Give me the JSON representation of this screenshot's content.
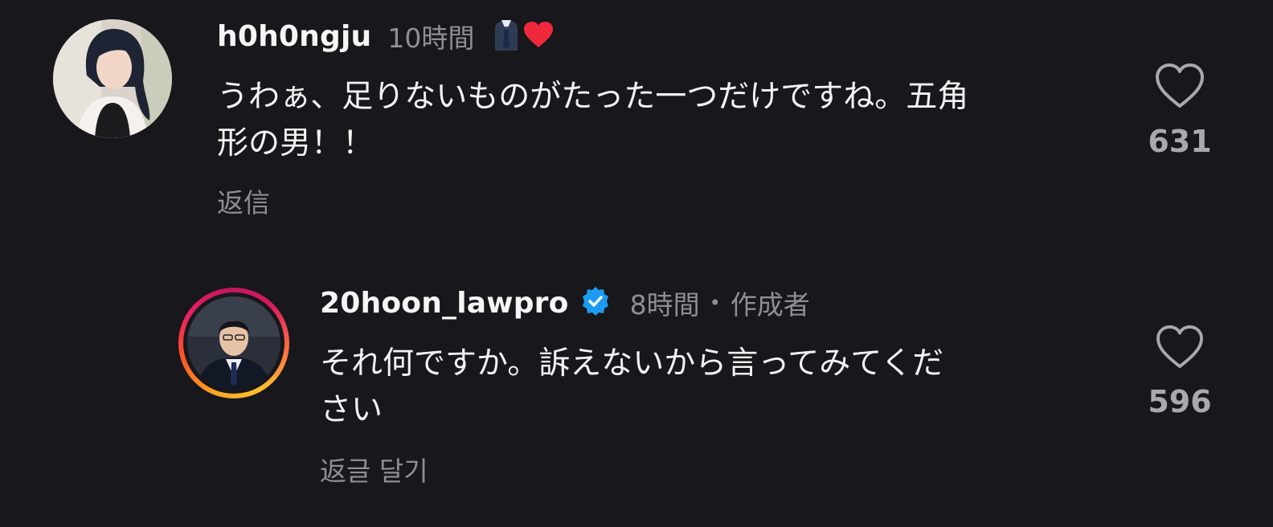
{
  "comments": [
    {
      "username": "h0h0ngju",
      "time": "10時間",
      "badge_icons": [
        "suit-emoji",
        "red-heart-emoji"
      ],
      "text_line1": "うわぁ、足りないものがたった一つだけですね。五角",
      "text_line2": "形の男！！",
      "reply_label": "返信",
      "like_count": "631"
    },
    {
      "username": "20hoon_lawpro",
      "verified": true,
      "time": "8時間",
      "separator": "•",
      "author_tag": "作成者",
      "text_line1": "それ何ですか。訴えないから言ってみてくだ",
      "text_line2": "さい",
      "reply_label": "返글 달기",
      "like_count": "596"
    }
  ],
  "colors": {
    "background": "#17171c",
    "verified_badge": "#1d9bf0",
    "muted_text": "#8e8e93",
    "heart_red": "#f0283c"
  }
}
